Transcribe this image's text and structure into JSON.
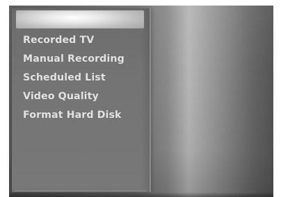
{
  "menu": {
    "items": [
      {
        "label": "Recorded TV"
      },
      {
        "label": "Manual Recording"
      },
      {
        "label": "Scheduled List"
      },
      {
        "label": "Video Quality"
      },
      {
        "label": "Format Hard Disk"
      }
    ]
  }
}
